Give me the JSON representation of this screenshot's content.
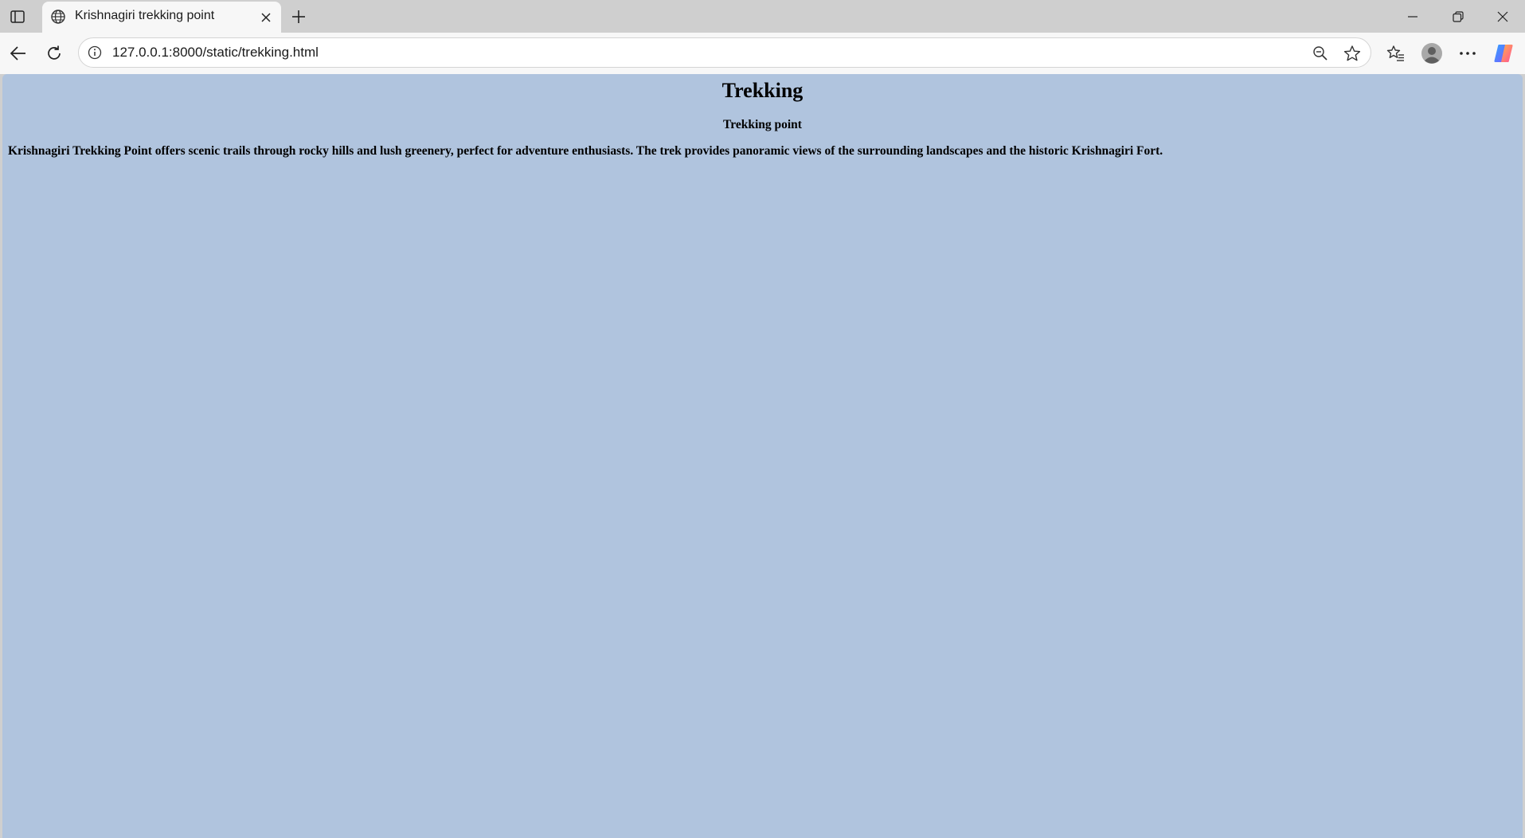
{
  "tab": {
    "title": "Krishnagiri trekking point"
  },
  "address_bar": {
    "url": "127.0.0.1:8000/static/trekking.html"
  },
  "icons": {
    "sidebar": "sidebar-toggle-icon",
    "favicon": "globe-icon",
    "tab_close": "close-icon",
    "new_tab": "plus-icon",
    "minimize": "minimize-icon",
    "maximize": "restore-icon",
    "window_close": "close-icon",
    "back": "back-arrow-icon",
    "reload": "reload-icon",
    "info": "info-icon",
    "zoom": "zoom-out-icon",
    "favorite": "star-icon",
    "favorites_list": "favorites-icon",
    "profile": "avatar-icon",
    "more": "more-icon",
    "copilot": "copilot-icon"
  },
  "page": {
    "background_color": "#b0c4de",
    "heading": "Trekking",
    "subheading": "Trekking point",
    "description": "Krishnagiri Trekking Point offers scenic trails through rocky hills and lush greenery, perfect for adventure enthusiasts. The trek provides panoramic views of the surrounding landscapes and the historic Krishnagiri Fort."
  }
}
